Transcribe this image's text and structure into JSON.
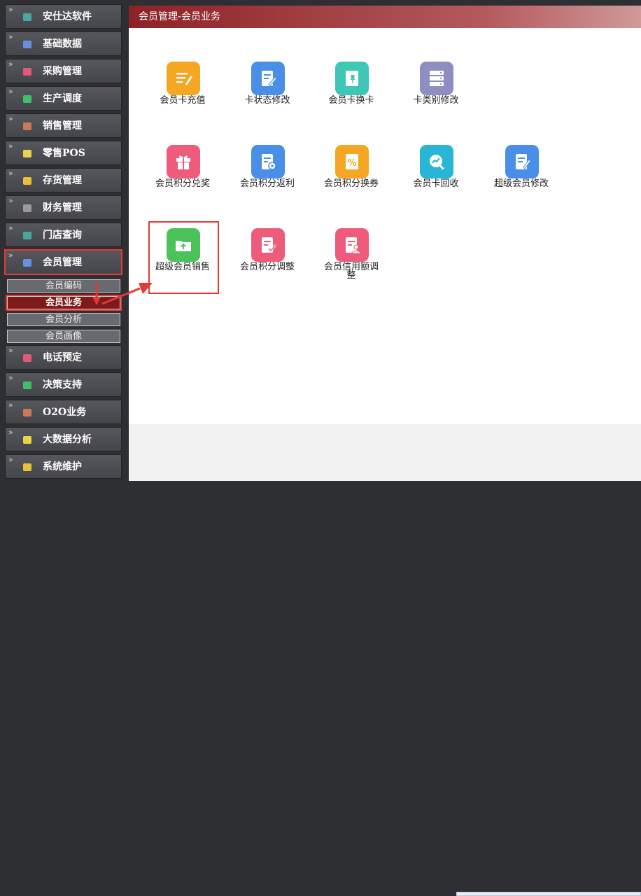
{
  "sidebar": {
    "items": [
      {
        "label": "安仕达软件",
        "icon": "software-icon",
        "color": "#4aa8a0"
      },
      {
        "label": "基础数据",
        "icon": "data-icon",
        "color": "#6a8fe0"
      },
      {
        "label": "采购管理",
        "icon": "purchase-icon",
        "color": "#e05a7a"
      },
      {
        "label": "生产调度",
        "icon": "production-icon",
        "color": "#3fbf6a"
      },
      {
        "label": "销售管理",
        "icon": "sales-icon",
        "color": "#c87a5a"
      },
      {
        "label": "零售POS",
        "icon": "pos-icon",
        "color": "#e8d24a"
      },
      {
        "label": "存货管理",
        "icon": "inventory-icon",
        "color": "#e8c03a"
      },
      {
        "label": "财务管理",
        "icon": "finance-icon",
        "color": "#9a9a9a"
      },
      {
        "label": "门店查询",
        "icon": "store-icon",
        "color": "#4aa8a0"
      },
      {
        "label": "会员管理",
        "icon": "member-icon",
        "color": "#6a8fe0"
      },
      {
        "label": "电话预定",
        "icon": "phone-icon",
        "color": "#e05a7a"
      },
      {
        "label": "决策支持",
        "icon": "decision-icon",
        "color": "#3fbf6a"
      },
      {
        "label": "O2O业务",
        "icon": "o2o-icon",
        "color": "#c87a5a"
      },
      {
        "label": "大数据分析",
        "icon": "bigdata-icon",
        "color": "#e8d24a"
      },
      {
        "label": "系统维护",
        "icon": "system-icon",
        "color": "#e8c03a"
      }
    ],
    "submenu": [
      "会员编码",
      "会员业务",
      "会员分析",
      "会员画像"
    ]
  },
  "main": {
    "title": "会员管理-会员业务",
    "tiles": [
      {
        "label": "会员卡充值",
        "icon": "card-recharge-icon",
        "color": "#f5a623"
      },
      {
        "label": "卡状态修改",
        "icon": "edit-document-icon",
        "color": "#4a8fe7"
      },
      {
        "label": "会员卡换卡",
        "icon": "pin-document-icon",
        "color": "#3ec6b6"
      },
      {
        "label": "卡类别修改",
        "icon": "server-list-icon",
        "color": "#8e8ec2"
      },
      {
        "label": "会员积分兑奖",
        "icon": "gift-icon",
        "color": "#ef5b7a"
      },
      {
        "label": "会员积分返利",
        "icon": "doc-settings-icon",
        "color": "#4a8fe7"
      },
      {
        "label": "会员积分换券",
        "icon": "percent-coupon-icon",
        "color": "#f5a623"
      },
      {
        "label": "会员卡回收",
        "icon": "search-chart-icon",
        "color": "#29b6d6"
      },
      {
        "label": "超级会员修改",
        "icon": "edit-pen-icon",
        "color": "#4a8fe7"
      },
      {
        "label": "超级会员销售",
        "icon": "folder-upload-icon",
        "color": "#4cc25a"
      },
      {
        "label": "会员积分调整",
        "icon": "doc-check-icon",
        "color": "#ef5b7a"
      },
      {
        "label": "会员信用额调整",
        "icon": "doc-user-icon",
        "color": "#ef5b7a"
      }
    ]
  }
}
